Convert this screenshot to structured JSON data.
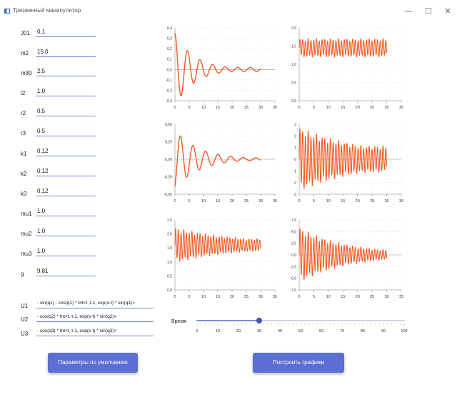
{
  "window": {
    "title": "Трезвенный манипулятор",
    "minimize_glyph": "—",
    "maximize_glyph": "☐",
    "close_glyph": "✕"
  },
  "params": [
    {
      "label": "J01",
      "value": "0.1"
    },
    {
      "label": "m2",
      "value": "15.0"
    },
    {
      "label": "m30",
      "value": "2.5"
    },
    {
      "label": "l2",
      "value": "1.0"
    },
    {
      "label": "r2",
      "value": "0.5"
    },
    {
      "label": "r3",
      "value": "0.5"
    },
    {
      "label": "k1",
      "value": "0.12"
    },
    {
      "label": "k2",
      "value": "0.12"
    },
    {
      "label": "k3",
      "value": "0.12"
    },
    {
      "label": "mu1",
      "value": "1.0"
    },
    {
      "label": "mu2",
      "value": "1.0"
    },
    {
      "label": "mu3",
      "value": "1.0"
    },
    {
      "label": "g",
      "value": "9.81"
    }
  ],
  "controls": [
    {
      "label": "U1",
      "value": "- sin(q1) - cos(q1) * Int<t, t-1, exp(x-t) * sin(q1)>"
    },
    {
      "label": "U2",
      "value": "- cos(q2) * Int<t, t-1, exp(x-t) * sin(q2)>"
    },
    {
      "label": "U3",
      "value": "- cos(q3) * Int<t, t-1, exp(x-t) * sin(q3)>"
    }
  ],
  "time_slider": {
    "label": "Время",
    "value": 30,
    "min": 0,
    "max": 100,
    "ticks": [
      "0",
      "10",
      "20",
      "30",
      "40",
      "50",
      "60",
      "70",
      "80",
      "90",
      "100"
    ]
  },
  "buttons": {
    "defaults": "Параметры по умолчанию",
    "plot": "Построить графики"
  },
  "colors": {
    "line": "#f15a24",
    "accent": "#5b6ed3",
    "slider_thumb": "#3f51b5"
  },
  "chart_data": [
    {
      "type": "line",
      "title": "",
      "xlabel": "",
      "ylabel": "",
      "xlim": [
        0,
        35
      ],
      "ylim": [
        -0.3,
        0.4
      ],
      "x_ticks": [
        "0",
        "5",
        "10",
        "15",
        "20",
        "25",
        "30",
        "35"
      ],
      "y_ticks": [
        "0,4",
        "0,3",
        "0,2",
        "0,1",
        "-0,0",
        "-0,1",
        "-0,2",
        "-0,3"
      ],
      "y_tick_values": [
        0.4,
        0.3,
        0.2,
        0.1,
        0.0,
        -0.1,
        -0.2,
        -0.3
      ],
      "series": [
        {
          "kind": "damped",
          "x_end": 30,
          "offset": 0,
          "amp": 0.35,
          "decay": 0.15,
          "period": 4.4,
          "phase": 1.57,
          "floor": 0.02
        }
      ]
    },
    {
      "type": "line",
      "title": "",
      "xlabel": "",
      "ylabel": "",
      "xlim": [
        0,
        35
      ],
      "ylim": [
        0.0,
        2.0
      ],
      "x_ticks": [
        "0",
        "5",
        "10",
        "15",
        "20",
        "25",
        "30",
        "35"
      ],
      "y_ticks": [
        "2,0",
        "1,5",
        "1,0",
        "0,5",
        "0,0"
      ],
      "y_tick_values": [
        2.0,
        1.5,
        1.0,
        0.5,
        0.0
      ],
      "series": [
        {
          "kind": "osc",
          "x_end": 30,
          "offset": 1.45,
          "amp": 0.22,
          "decay": 0.0,
          "period": 0.95,
          "phase": 0.0,
          "floor": 0.15
        }
      ]
    },
    {
      "type": "line",
      "title": "",
      "xlabel": "",
      "ylabel": "",
      "xlim": [
        0,
        35
      ],
      "ylim": [
        -0.5,
        0.5
      ],
      "x_ticks": [
        "0",
        "5",
        "10",
        "15",
        "20",
        "25",
        "30",
        "35"
      ],
      "y_ticks": [
        "0,50",
        "0,25",
        "0,00",
        "-0,25",
        "-0,50"
      ],
      "y_tick_values": [
        0.5,
        0.25,
        0.0,
        -0.25,
        -0.5
      ],
      "series": [
        {
          "kind": "damped",
          "x_end": 30,
          "offset": 0,
          "amp": 0.42,
          "decay": 0.12,
          "period": 4.4,
          "phase": -1.2,
          "floor": 0.02
        }
      ]
    },
    {
      "type": "line",
      "title": "",
      "xlabel": "",
      "ylabel": "",
      "xlim": [
        0,
        35
      ],
      "ylim": [
        -3,
        3
      ],
      "x_ticks": [
        "0",
        "5",
        "10",
        "15",
        "20",
        "25",
        "30",
        "35"
      ],
      "y_ticks": [
        "3",
        "2",
        "1",
        "0",
        "-1",
        "-2",
        "-3"
      ],
      "y_tick_values": [
        3,
        2,
        1,
        0,
        -1,
        -2,
        -3
      ],
      "series": [
        {
          "kind": "osc",
          "x_end": 30,
          "offset": 0,
          "amp": 2.4,
          "decay": 0.04,
          "period": 0.95,
          "phase": 0.0,
          "floor": 1.0
        }
      ]
    },
    {
      "type": "line",
      "title": "",
      "xlabel": "",
      "ylabel": "",
      "xlim": [
        0,
        35
      ],
      "ylim": [
        0.0,
        2.5
      ],
      "x_ticks": [
        "0",
        "5",
        "10",
        "15",
        "20",
        "25",
        "30",
        "35"
      ],
      "y_ticks": [
        "2,5",
        "2,0",
        "1,5",
        "1,0",
        "0,5",
        "0,0"
      ],
      "y_tick_values": [
        2.5,
        2.0,
        1.5,
        1.0,
        0.5,
        0.0
      ],
      "series": [
        {
          "kind": "osc",
          "x_end": 30,
          "offset": 1.6,
          "amp": 0.55,
          "decay": 0.04,
          "period": 0.95,
          "phase": 0.0,
          "floor": 0.2
        }
      ]
    },
    {
      "type": "line",
      "title": "",
      "xlabel": "",
      "ylabel": "",
      "xlim": [
        0,
        35
      ],
      "ylim": [
        -7.5,
        7.5
      ],
      "x_ticks": [
        "0",
        "5",
        "10",
        "15",
        "20",
        "25",
        "30",
        "35"
      ],
      "y_ticks": [
        "7,5",
        "5,0",
        "2,5",
        "0,0",
        "-2,5",
        "-5,0",
        "-7,5"
      ],
      "y_tick_values": [
        7.5,
        5.0,
        2.5,
        0.0,
        -2.5,
        -5.0,
        -7.5
      ],
      "series": [
        {
          "kind": "osc",
          "x_end": 30,
          "offset": 0,
          "amp": 5.2,
          "decay": 0.06,
          "period": 0.95,
          "phase": 0.0,
          "floor": 1.0
        }
      ]
    }
  ]
}
